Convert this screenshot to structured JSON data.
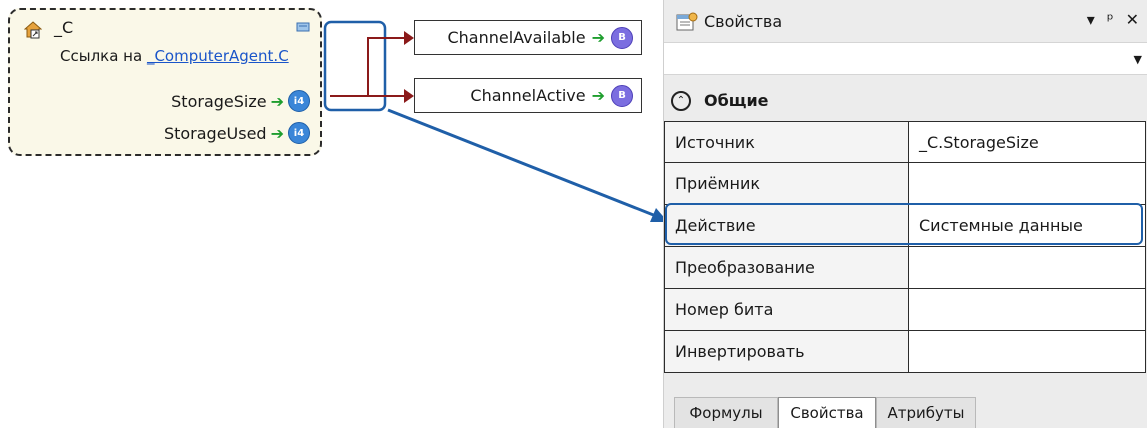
{
  "node": {
    "title": "_C",
    "ref_prefix": "Ссылка на",
    "ref_link": "_ComputerAgent.C",
    "pins": [
      {
        "label": "StorageSize",
        "type": "i4"
      },
      {
        "label": "StorageUsed",
        "type": "i4"
      }
    ]
  },
  "channels": [
    {
      "label": "ChannelAvailable",
      "type": "B"
    },
    {
      "label": "ChannelActive",
      "type": "B"
    }
  ],
  "panel": {
    "title": "Свойства",
    "controls": [
      "▾",
      "ᵖ",
      "✕"
    ],
    "group": "Общие",
    "rows": [
      {
        "name": "Источник",
        "value": "_C.StorageSize"
      },
      {
        "name": "Приёмник",
        "value": ""
      },
      {
        "name": "Действие",
        "value": "Системные данные"
      },
      {
        "name": "Преобразование",
        "value": ""
      },
      {
        "name": "Номер бита",
        "value": ""
      },
      {
        "name": "Инвертировать",
        "value": ""
      }
    ],
    "tabs": [
      "Формулы",
      "Свойства",
      "Атрибуты"
    ],
    "active_tab": "Свойства"
  },
  "colors": {
    "highlight": "#1f5fa8",
    "link_arrow": "#8b1a1a",
    "node_bg": "#faf8e8"
  }
}
